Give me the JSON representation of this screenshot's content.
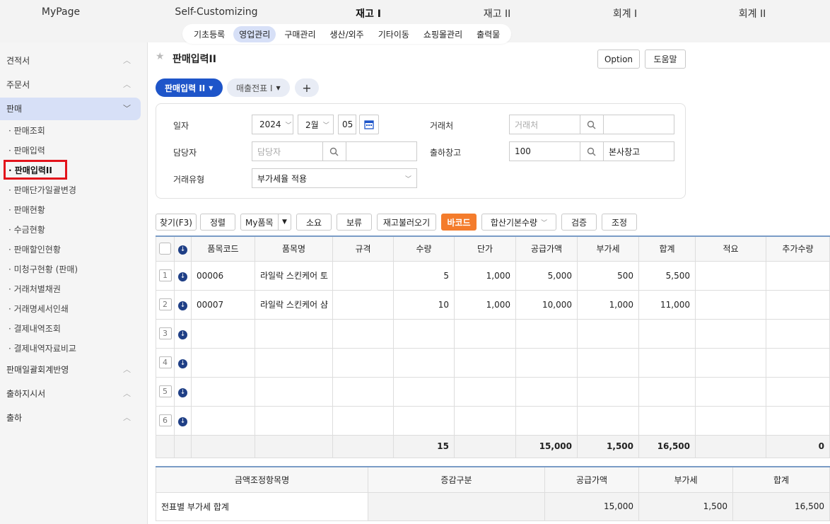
{
  "topnav": {
    "items": [
      "MyPage",
      "Self-Customizing",
      "재고 I",
      "재고 II",
      "회계 I",
      "회계 II"
    ],
    "active": "재고 I"
  },
  "subnav": {
    "items": [
      "기초등록",
      "영업관리",
      "구매관리",
      "생산/외주",
      "기타이동",
      "쇼핑몰관리",
      "출력물"
    ],
    "active": "영업관리"
  },
  "sidebar": {
    "sections": [
      "견적서",
      "주문서",
      "판매",
      "판매일괄회계반영",
      "출하지시서",
      "출하"
    ],
    "open": "판매",
    "items": [
      "판매조회",
      "판매입력",
      "판매입력II",
      "판매단가일괄변경",
      "판매현황",
      "수금현황",
      "판매할인현황",
      "미청구현황 (판매)",
      "거래처별채권",
      "거래명세서인쇄",
      "결제내역조회",
      "결제내역자료비교"
    ],
    "current": "판매입력II"
  },
  "page": {
    "title": "판매입력II",
    "option_label": "Option",
    "help_label": "도움말"
  },
  "tabs": {
    "active": "판매입력 II",
    "other": "매출전표 I",
    "add": "+"
  },
  "form": {
    "date_label": "일자",
    "year": "2024",
    "month": "2월",
    "day": "05",
    "client_label": "거래처",
    "client_placeholder": "거래처",
    "manager_label": "담당자",
    "manager_placeholder": "담당자",
    "warehouse_label": "출하창고",
    "warehouse_code": "100",
    "warehouse_name": "본사창고",
    "type_label": "거래유형",
    "type_value": "부가세율 적용"
  },
  "toolbar": {
    "find": "찾기(F3)",
    "sort": "정렬",
    "myitem": "My품목",
    "consume": "소요",
    "hold": "보류",
    "stock_load": "재고불러오기",
    "barcode": "바코드",
    "sum_qty": "합산기본수량",
    "verify": "검증",
    "adjust": "조정"
  },
  "grid": {
    "headers": [
      "품목코드",
      "품목명",
      "규격",
      "수량",
      "단가",
      "공급가액",
      "부가세",
      "합계",
      "적요",
      "추가수량"
    ],
    "rows": [
      {
        "no": "1",
        "code": "00006",
        "name": "라일락 스킨케어 토",
        "spec": "",
        "qty": "5",
        "price": "1,000",
        "supply": "5,000",
        "vat": "500",
        "total": "5,500",
        "memo": "",
        "extra": ""
      },
      {
        "no": "2",
        "code": "00007",
        "name": "라일락 스킨케어 샴",
        "spec": "",
        "qty": "10",
        "price": "1,000",
        "supply": "10,000",
        "vat": "1,000",
        "total": "11,000",
        "memo": "",
        "extra": ""
      },
      {
        "no": "3",
        "code": "",
        "name": "",
        "spec": "",
        "qty": "",
        "price": "",
        "supply": "",
        "vat": "",
        "total": "",
        "memo": "",
        "extra": ""
      },
      {
        "no": "4",
        "code": "",
        "name": "",
        "spec": "",
        "qty": "",
        "price": "",
        "supply": "",
        "vat": "",
        "total": "",
        "memo": "",
        "extra": ""
      },
      {
        "no": "5",
        "code": "",
        "name": "",
        "spec": "",
        "qty": "",
        "price": "",
        "supply": "",
        "vat": "",
        "total": "",
        "memo": "",
        "extra": ""
      },
      {
        "no": "6",
        "code": "",
        "name": "",
        "spec": "",
        "qty": "",
        "price": "",
        "supply": "",
        "vat": "",
        "total": "",
        "memo": "",
        "extra": ""
      }
    ],
    "totals": {
      "qty": "15",
      "supply": "15,000",
      "vat": "1,500",
      "total": "16,500",
      "extra": "0"
    }
  },
  "adjust_table": {
    "headers": [
      "금액조정항목명",
      "증감구분",
      "공급가액",
      "부가세",
      "합계"
    ],
    "row": {
      "name": "전표별 부가세 합계",
      "kind": "",
      "supply": "15,000",
      "vat": "1,500",
      "total": "16,500"
    }
  },
  "colors": {
    "primary": "#1e55c9",
    "barcode": "#f47c2c",
    "highlight": "#e3131b",
    "active_bg": "#d7e0f7"
  }
}
